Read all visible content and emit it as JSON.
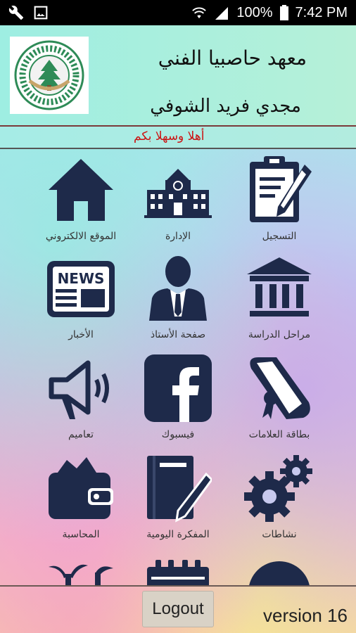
{
  "status_bar": {
    "battery": "100%",
    "time": "7:42 PM",
    "icons": [
      "wrench-icon",
      "image-icon",
      "wifi-icon",
      "signal-icon",
      "battery-icon"
    ]
  },
  "header": {
    "title": "معهد حاصبيا الفني",
    "subtitle": "مجدي فريد الشوفي",
    "welcome": "أهلا وسهلا بكم"
  },
  "menu": {
    "items": [
      {
        "label": "التسجيل",
        "icon": "clipboard-icon"
      },
      {
        "label": "الإدارة",
        "icon": "school-building-icon"
      },
      {
        "label": "الموقع الالكتروني",
        "icon": "home-icon"
      },
      {
        "label": "مراحل الدراسة",
        "icon": "institution-icon"
      },
      {
        "label": "صفحة الأستاذ",
        "icon": "teacher-icon"
      },
      {
        "label": "الأخبار",
        "icon": "news-icon"
      },
      {
        "label": "بطاقة العلامات",
        "icon": "diploma-icon"
      },
      {
        "label": "فيسبوك",
        "icon": "facebook-icon"
      },
      {
        "label": "تعاميم",
        "icon": "megaphone-icon"
      },
      {
        "label": "نشاطات",
        "icon": "gears-icon"
      },
      {
        "label": "المفكرة اليومية",
        "icon": "notebook-icon"
      },
      {
        "label": "المحاسبة",
        "icon": "wallet-icon"
      }
    ]
  },
  "footer": {
    "logout_label": "Logout",
    "version": "version 16"
  },
  "colors": {
    "icon": "#1e2a4a",
    "welcome_text": "#cc1111"
  }
}
